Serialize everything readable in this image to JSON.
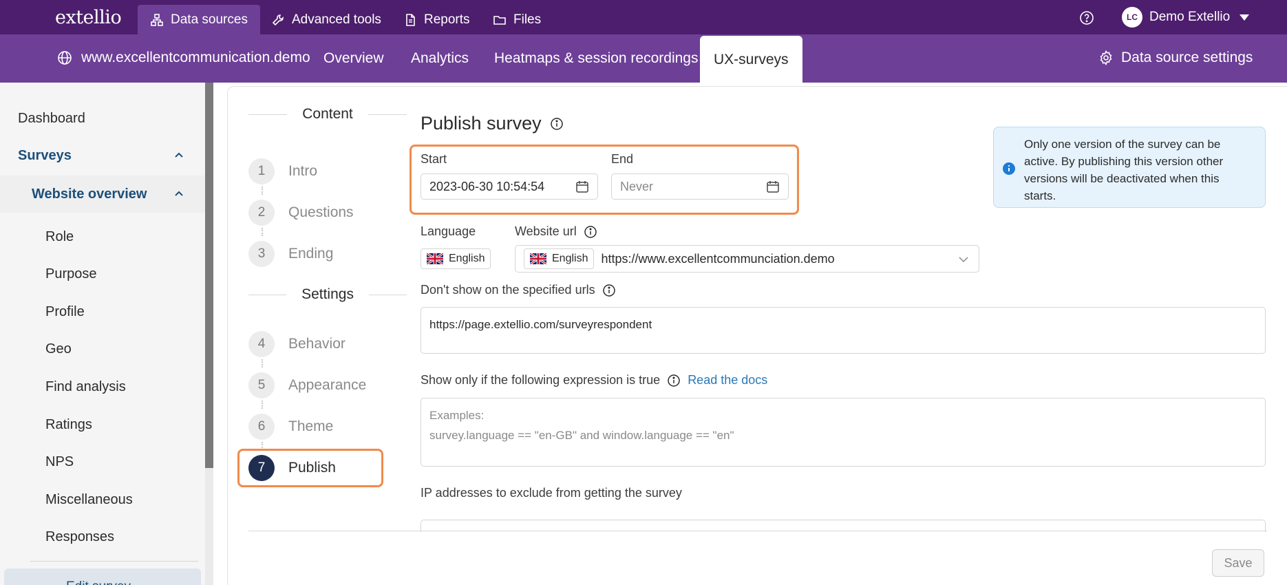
{
  "brand": {
    "logo_text": "extellio"
  },
  "topnav": {
    "items": [
      {
        "label": "Data sources",
        "icon": "sitemap-icon",
        "active": true
      },
      {
        "label": "Advanced tools",
        "icon": "wrench-icon",
        "active": false
      },
      {
        "label": "Reports",
        "icon": "document-icon",
        "active": false
      },
      {
        "label": "Files",
        "icon": "folder-icon",
        "active": false
      }
    ],
    "help_icon": "help-circle-icon",
    "user": {
      "initials": "LC",
      "name": "Demo Extellio"
    }
  },
  "subnav": {
    "site": "www.excellentcommunication.demo",
    "tabs": [
      {
        "label": "Overview",
        "active": false
      },
      {
        "label": "Analytics",
        "active": false
      },
      {
        "label": "Heatmaps & session recordings",
        "active": false
      },
      {
        "label": "UX-surveys",
        "active": true
      }
    ],
    "settings_label": "Data source settings"
  },
  "sidebar": {
    "dashboard": "Dashboard",
    "surveys": "Surveys",
    "website_overview": "Website overview",
    "items": [
      "Role",
      "Purpose",
      "Profile",
      "Geo",
      "Find analysis",
      "Ratings",
      "NPS",
      "Miscellaneous",
      "Responses"
    ],
    "edit_survey": "Edit survey"
  },
  "steps": {
    "content_heading": "Content",
    "settings_heading": "Settings",
    "content": [
      {
        "num": "1",
        "label": "Intro"
      },
      {
        "num": "2",
        "label": "Questions"
      },
      {
        "num": "3",
        "label": "Ending"
      }
    ],
    "settings": [
      {
        "num": "4",
        "label": "Behavior"
      },
      {
        "num": "5",
        "label": "Appearance"
      },
      {
        "num": "6",
        "label": "Theme"
      },
      {
        "num": "7",
        "label": "Publish",
        "active": true
      }
    ]
  },
  "form": {
    "title": "Publish survey",
    "start_label": "Start",
    "start_value": "2023-06-30 10:54:54",
    "end_label": "End",
    "end_placeholder": "Never",
    "language_label": "Language",
    "language_value": "English",
    "website_url_label": "Website url",
    "website_url_lang": "English",
    "website_url_value": "https://www.excellentcommunciation.demo",
    "exclude_urls_label": "Don't show on the specified urls",
    "exclude_urls_value": "https://page.extellio.com/surveyrespondent",
    "expression_label": "Show only if the following expression is true",
    "read_docs": "Read the docs",
    "expression_placeholder_1": "Examples:",
    "expression_placeholder_2": "survey.language == \"en-GB\" and window.language == \"en\"",
    "ip_label": "IP addresses to exclude from getting the survey",
    "notice": "Only one version of the survey can be active. By publishing this version other versions will be deactivated when this starts.",
    "save_label": "Save"
  },
  "colors": {
    "topbar": "#4d1e6d",
    "subbar": "#6d3f97",
    "highlight": "#f08a4b",
    "active_step": "#1e2d50",
    "link": "#2a78b5"
  }
}
